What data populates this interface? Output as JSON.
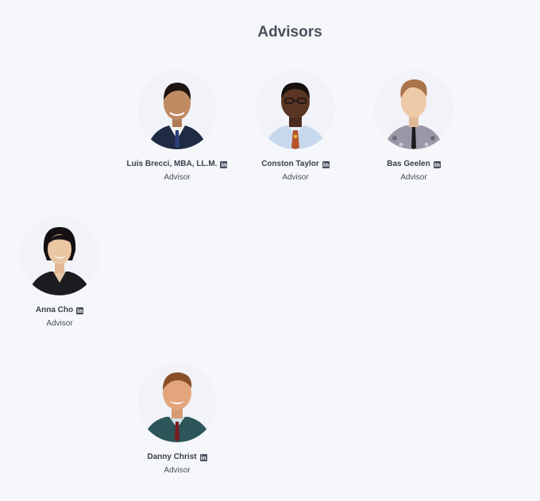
{
  "section": {
    "title": "Advisors"
  },
  "advisors": [
    {
      "name": "Luis Brecci, MBA, LL.M.",
      "role": "Advisor",
      "linkedin_icon": "linkedin-icon"
    },
    {
      "name": "Conston Taylor",
      "role": "Advisor",
      "linkedin_icon": "linkedin-icon"
    },
    {
      "name": "Bas Geelen",
      "role": "Advisor",
      "linkedin_icon": "linkedin-icon"
    },
    {
      "name": "Anna Cho",
      "role": "Advisor",
      "linkedin_icon": "linkedin-icon"
    },
    {
      "name": "Danny Christ",
      "role": "Advisor",
      "linkedin_icon": "linkedin-icon"
    }
  ],
  "colors": {
    "background": "#f6f7fb",
    "text": "#3b404c",
    "icon": "#4a4f5c"
  }
}
